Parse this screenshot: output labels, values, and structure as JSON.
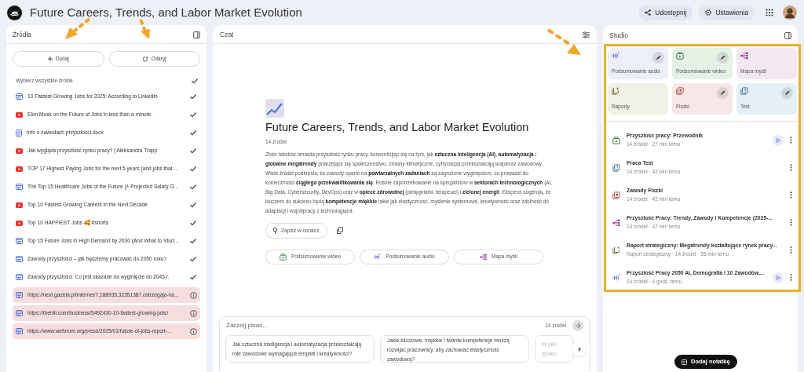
{
  "header": {
    "title": "Future Careers, Trends, and Labor Market Evolution",
    "share": "Udostępnij",
    "settings": "Ustawienia"
  },
  "sources": {
    "title": "Źródła",
    "add": "Dodaj",
    "discover": "Odkryj",
    "select_all": {
      "label": "Wybierz wszystkie źródła",
      "checked": true
    },
    "items": [
      {
        "kind": "web",
        "title": "10 Fastest-Growing Jobs for 2025: According to Linkedin",
        "checked": true,
        "failed": false
      },
      {
        "kind": "youtube",
        "title": "Elon Musk on the Future of Jobs in less than a minute.",
        "checked": true,
        "failed": false
      },
      {
        "kind": "doc",
        "title": "Info o zawodach przyszłości.docx",
        "checked": true,
        "failed": false
      },
      {
        "kind": "youtube",
        "title": "Jak wygląda przyszłość rynku pracy? | Aleksandra Trapp",
        "checked": true,
        "failed": false
      },
      {
        "kind": "youtube",
        "title": "TOP 17 Highest Paying Jobs for the next 5 years (and jobs that ...",
        "checked": true,
        "failed": false
      },
      {
        "kind": "web",
        "title": "The Top 15 Healthcare Jobs of the Future (+ Projected Salary G...",
        "checked": true,
        "failed": false
      },
      {
        "kind": "youtube",
        "title": "Top 10 Fastest Growing Careers in the Next Decade",
        "checked": true,
        "failed": false
      },
      {
        "kind": "youtube",
        "title": "Top 10 HAPPIEST Jobs 🥰 #shorts",
        "checked": true,
        "failed": false
      },
      {
        "kind": "web",
        "title": "Top 15 Future Jobs in High Demand by 2030 (And What to Stud...",
        "checked": true,
        "failed": false
      },
      {
        "kind": "web",
        "title": "Zawody przyszłości – jak będziemy pracować do 2050 roku?",
        "checked": true,
        "failed": false
      },
      {
        "kind": "web",
        "title": "Zawody przyszłości. Co jest skazane na wyginięcie do 2045 r.",
        "checked": true,
        "failed": false
      },
      {
        "kind": "web",
        "title": "https://next.gazeta.pl/internet/7,188935,32351387,ostrzegaja-na...",
        "failed": true
      },
      {
        "kind": "web",
        "title": "https://thehill.com/business/5492430-10-fastest-growing-jobs/",
        "failed": true
      },
      {
        "kind": "web",
        "title": "https://www.weforum.org/press/2025/01/future-of-jobs-report-...",
        "failed": true
      }
    ]
  },
  "chat": {
    "title": "Czat",
    "notebook_title": "Future Careers, Trends, and Labor Market Evolution",
    "source_count": "14 źródeł",
    "summary": "Zbiór tekstów omawia przyszłość rynku pracy, koncentrując się na tym, jak **sztuczna inteligencja (AI)**, **automatyzacja** i **globalne megatrendy** (starzejące się społeczeństwo, zmiany klimatyczne, cyfryzacja) przekształcają krajobraz zawodowy. Wiele źródeł podkreśla, że zawody oparte na **powtarzalnych zadaniach** są zagrożone wyginięciem, co prowadzi do konieczności **ciągłego przekwalifikowania się**. Rośnie zapotrzebowanie na specjalistów w **sektorach technologicznych** (AI, Big Data, Cybersecurity, DevOps) oraz w **opiece zdrowotnej** (pielęgniarki, terapeuci) i **zielonej energii**. Eksperci sugerują, że kluczem do sukcesu będą **kompetencje miękkie** takie jak elastyczność, myślenie systemowe, kreatywność oraz zdolność do adaptacji i współpracy z technologiami.",
    "save_note": "Zapisz w notatce",
    "chips": [
      {
        "kind": "video",
        "label": "Podsumowanie wideo"
      },
      {
        "kind": "audio",
        "label": "Podsumowanie audio"
      },
      {
        "kind": "mindmap",
        "label": "Mapa myśli"
      }
    ],
    "input": {
      "placeholder": "Zacznij pisać...",
      "source_count": "14 źródeł"
    },
    "suggestions": [
      "Jak sztuczna inteligencja i automatyzacja przekształcają role zawodowe wymagające empatii i kreatywności?",
      "Jakie kluczowe, miękkie i twarde kompetencje muszą rozwijać pracownicy, aby zachować elastyczność zawodową?",
      "W jaki społec"
    ]
  },
  "studio": {
    "title": "Studio",
    "tiles": [
      {
        "kind": "audio",
        "label": "Podsumowanie audio",
        "color": "#eceef8",
        "editable": true
      },
      {
        "kind": "video",
        "label": "Podsumowanie wideo",
        "color": "#e6f1e6",
        "editable": true
      },
      {
        "kind": "mindmap",
        "label": "Mapa myśli",
        "color": "#f3e8f0",
        "editable": false
      },
      {
        "kind": "report",
        "label": "Raporty",
        "color": "#f1f0e6",
        "editable": false
      },
      {
        "kind": "flashcards",
        "label": "Fiszki",
        "color": "#f7e8e7",
        "editable": true
      },
      {
        "kind": "quiz",
        "label": "Test",
        "color": "#e4eff6",
        "editable": true
      }
    ],
    "outputs": [
      {
        "kind": "video",
        "title": "Przyszłość pracy: Przewodnik",
        "meta": "14 źródeł · 27 min temu",
        "playable": true
      },
      {
        "kind": "quiz",
        "title": "Praca Test",
        "meta": "14 źródeł · 42 min temu",
        "playable": false
      },
      {
        "kind": "flashcards",
        "title": "Zawody Fiszki",
        "meta": "14 źródeł · 42 min temu",
        "playable": false
      },
      {
        "kind": "mindmap",
        "title": "Przyszłość Pracy: Trendy, Zawody i Kompetencje (2025-...",
        "meta": "14 źródeł · 47 min temu",
        "playable": false
      },
      {
        "kind": "report",
        "title": "Raport strategiczny: Megatrendy kształtujące rynek pracy...",
        "meta": "Raport strategiczny · 14 źródeł · 55 min temu",
        "playable": false
      },
      {
        "kind": "audio",
        "title": "Przyszłość Pracy 2050 AI, Demografia i 10 Zawodów,...",
        "meta": "14 źródeł · 4 godz. temu",
        "playable": true
      }
    ],
    "add_note": "Dodaj notatkę"
  }
}
